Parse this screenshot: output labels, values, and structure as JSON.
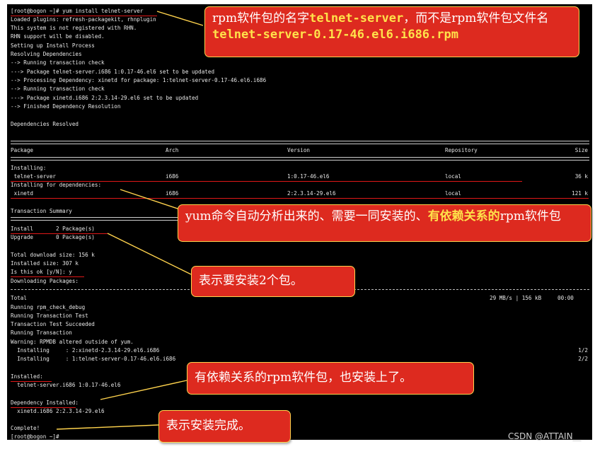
{
  "terminal": {
    "top": [
      "[root@bogon ~]# yum install telnet-server",
      "Loaded plugins: refresh-packagekit, rhnplugin",
      "This system is not registered with RHN.",
      "RHN support will be disabled.",
      "Setting up Install Process",
      "Resolving Dependencies",
      "--> Running transaction check",
      "---> Package telnet-server.i686 1:0.17-46.el6 set to be updated",
      "--> Processing Dependency: xinetd for package: 1:telnet-server-0.17-46.el6.i686",
      "--> Running transaction check",
      "---> Package xinetd.i686 2:2.3.14-29.el6 set to be updated",
      "--> Finished Dependency Resolution",
      "",
      "Dependencies Resolved"
    ],
    "table_headers": [
      "Package",
      "Arch",
      "Version",
      "Repository",
      "Size"
    ],
    "installing_label": "Installing:",
    "deps_label": "Installing for dependencies:",
    "rows": [
      {
        "package": " telnet-server",
        "arch": "i686",
        "version": "1:0.17-46.el6",
        "repo": "local",
        "size": "36 k"
      },
      {
        "package": " xinetd",
        "arch": "i686",
        "version": "2:2.3.14-29.el6",
        "repo": "local",
        "size": "121 k"
      }
    ],
    "summary": [
      "Transaction Summary",
      "Install       2 Package(s)",
      "Upgrade       0 Package(s)",
      "",
      "Total download size: 156 k",
      "Installed size: 307 k",
      "Is this ok [y/N]: y",
      "Downloading Packages:"
    ],
    "total": {
      "label": "Total",
      "rate": "29 MB/s | 156 kB     00:00"
    },
    "run": [
      "Running rpm_check_debug",
      "Running Transaction Test",
      "Transaction Test Succeeded",
      "Running Transaction",
      "Warning: RPMDB altered outside of yum."
    ],
    "progress": [
      {
        "text": "  Installing     : 2:xinetd-2.3.14-29.el6.i686",
        "count": "1/2"
      },
      {
        "text": "  Installing     : 1:telnet-server-0.17-46.el6.i686",
        "count": "2/2"
      }
    ],
    "tail": [
      "Installed:",
      "  telnet-server.i686 1:0.17-46.el6",
      "",
      "Dependency Installed:",
      "  xinetd.i686 2:2.3.14-29.el6",
      "",
      "Complete!",
      "[root@bogon ~]#"
    ]
  },
  "callouts": {
    "c1": {
      "a": "rpm软件包的名字",
      "b": "telnet-server",
      "c": "，而不是rpm软件包文件名",
      "d": "telnet-server-0.17-46.el6.i686.rpm"
    },
    "c2": {
      "a": "yum命令自动分析出来的、需要一同安装的、",
      "b": "有依赖关系的",
      "c": "rpm软件包"
    },
    "c3": {
      "a": "表示要安装2个包。"
    },
    "c4": {
      "a": "有依赖关系的rpm软件包，也安装上了。"
    },
    "c5": {
      "a": "表示安装完成。"
    }
  },
  "watermark": "CSDN @ATTAIN__",
  "colors": {
    "callout_bg": "#dd2a1f",
    "callout_border": "#ffd34d",
    "highlight": "#ffe24a",
    "underline": "#e01818"
  }
}
